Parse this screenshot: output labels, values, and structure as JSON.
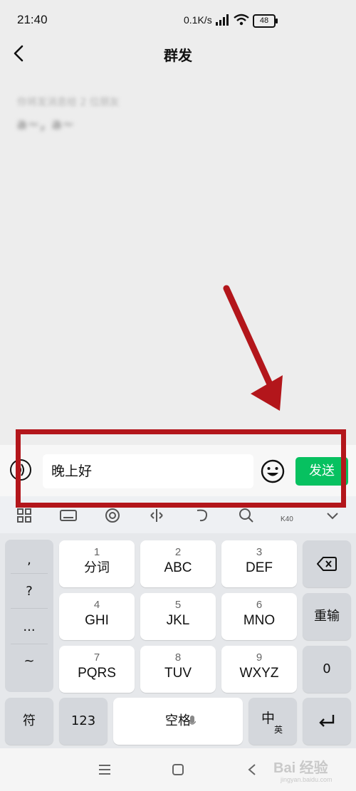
{
  "status_bar": {
    "time": "21:40",
    "net_speed": "0.1K/s",
    "battery": "48"
  },
  "header": {
    "title": "群发"
  },
  "recipients": {
    "hint": "你将发消息给 2 位朋友",
    "names": "a~, a~"
  },
  "input_bar": {
    "message_value": "晚上好",
    "send_label": "发送"
  },
  "toolbar": {
    "icons": [
      "apps-icon",
      "keyboard-icon",
      "clipboard-icon",
      "cursor-icon",
      "handwriting-icon",
      "search-icon",
      "k40-icon",
      "collapse-icon"
    ],
    "notification_dot_color": "#e53935"
  },
  "keyboard": {
    "punctuation": [
      ",",
      "?",
      "...",
      "~"
    ],
    "keys": [
      {
        "num": "1",
        "label": "分词"
      },
      {
        "num": "2",
        "label": "ABC"
      },
      {
        "num": "3",
        "label": "DEF"
      },
      {
        "num": "4",
        "label": "GHI"
      },
      {
        "num": "5",
        "label": "JKL"
      },
      {
        "num": "6",
        "label": "MNO"
      },
      {
        "num": "7",
        "label": "PQRS"
      },
      {
        "num": "8",
        "label": "TUV"
      },
      {
        "num": "9",
        "label": "WXYZ"
      }
    ],
    "reinput_label": "重输",
    "zero_label": "0",
    "symbol_label": "符",
    "numbers_label": "123",
    "space_label": "空格",
    "lang_main": "中",
    "lang_sub": "英"
  },
  "watermark": {
    "text": "Bai 经验",
    "sub": "jingyan.baidu.com"
  },
  "colors": {
    "accent_green": "#07c160",
    "annotation_red": "#b3161b"
  }
}
